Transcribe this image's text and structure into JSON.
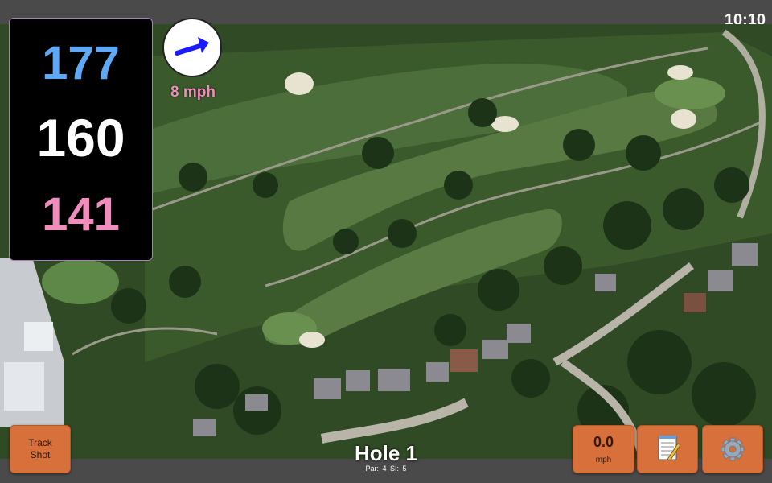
{
  "status_bar": {
    "time": "10:10"
  },
  "distances": {
    "back": "177",
    "middle": "160",
    "front": "141"
  },
  "wind": {
    "speed": "8 mph",
    "icon": "arrow-right-icon"
  },
  "buttons": {
    "track_shot_line1": "Track",
    "track_shot_line2": "Shot",
    "speed_value": "0.0",
    "speed_unit": "mph",
    "notes_icon": "notepad-icon",
    "settings_icon": "gear-icon"
  },
  "hole": {
    "title": "Hole 1",
    "par": "Par: 4",
    "si": "SI: 5"
  },
  "colors": {
    "back": "#5fa8f5",
    "middle": "#ffffff",
    "front": "#f08dbd",
    "button": "#d8703c",
    "bar": "#4a4a4a"
  }
}
